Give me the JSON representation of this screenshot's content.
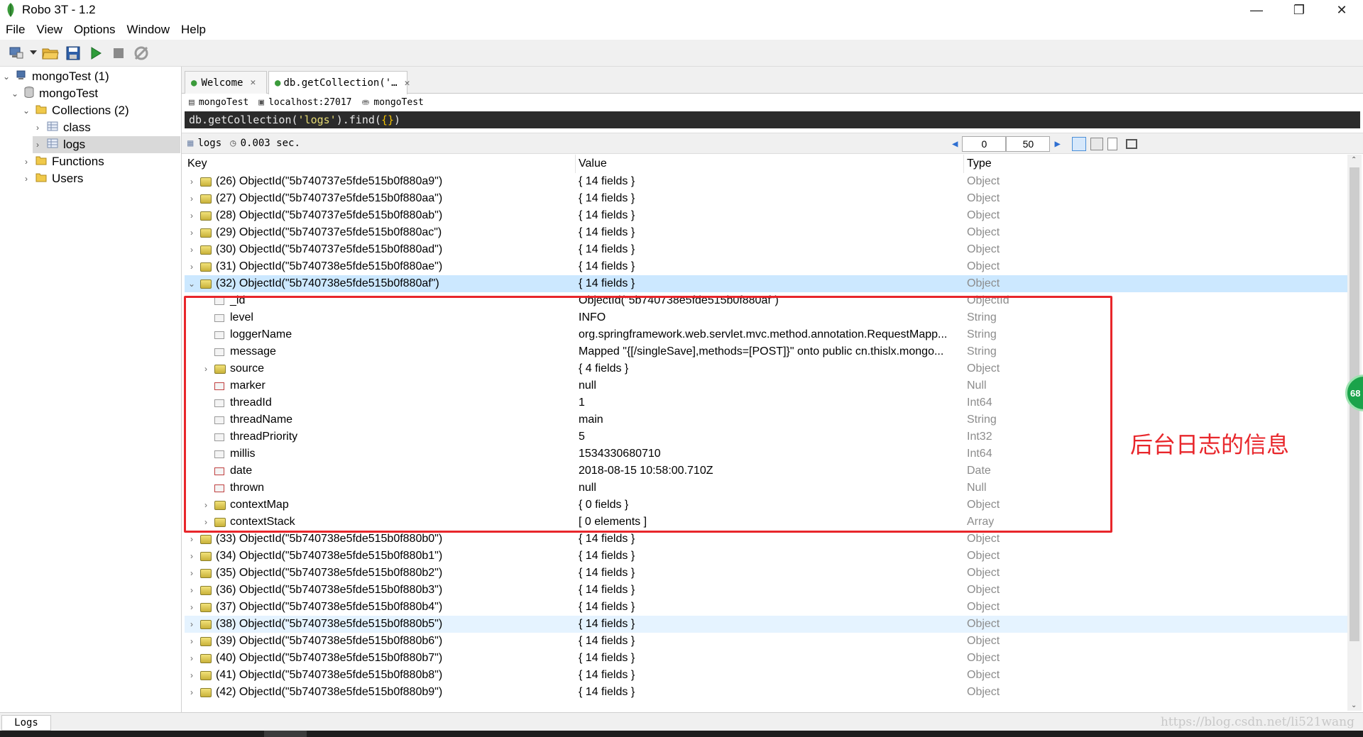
{
  "window": {
    "title": "Robo 3T - 1.2"
  },
  "menu": [
    "File",
    "View",
    "Options",
    "Window",
    "Help"
  ],
  "toolbar": {
    "icons": [
      "connect-icon",
      "dropdown-icon",
      "open-folder-icon",
      "save-icon",
      "run-icon",
      "stop-icon",
      "tools-icon"
    ]
  },
  "tree": {
    "connection": "mongoTest (1)",
    "database": "mongoTest",
    "collections": "Collections (2)",
    "items": [
      "class",
      "logs"
    ],
    "functions": "Functions",
    "users": "Users"
  },
  "tabs": [
    {
      "label": "Welcome"
    },
    {
      "label": "db.getCollection('…"
    }
  ],
  "connbar": {
    "db": "mongoTest",
    "host": "localhost:27017",
    "db2": "mongoTest"
  },
  "query": {
    "prefix": "db.getCollection(",
    "arg": "'logs'",
    "mid": ").find(",
    "args": "{}",
    "suffix": ")"
  },
  "results": {
    "collection": "logs",
    "time": "0.003 sec.",
    "skip": "0",
    "limit": "50"
  },
  "grid": {
    "headers": {
      "key": "Key",
      "value": "Value",
      "type": "Type"
    },
    "rows_before": [
      {
        "key": "(26) ObjectId(\"5b740737e5fde515b0f880a9\")",
        "value": "{ 14 fields }",
        "type": "Object"
      },
      {
        "key": "(27) ObjectId(\"5b740737e5fde515b0f880aa\")",
        "value": "{ 14 fields }",
        "type": "Object"
      },
      {
        "key": "(28) ObjectId(\"5b740737e5fde515b0f880ab\")",
        "value": "{ 14 fields }",
        "type": "Object"
      },
      {
        "key": "(29) ObjectId(\"5b740737e5fde515b0f880ac\")",
        "value": "{ 14 fields }",
        "type": "Object"
      },
      {
        "key": "(30) ObjectId(\"5b740737e5fde515b0f880ad\")",
        "value": "{ 14 fields }",
        "type": "Object"
      },
      {
        "key": "(31) ObjectId(\"5b740738e5fde515b0f880ae\")",
        "value": "{ 14 fields }",
        "type": "Object"
      }
    ],
    "expanded": {
      "key": "(32) ObjectId(\"5b740738e5fde515b0f880af\")",
      "value": "{ 14 fields }",
      "type": "Object"
    },
    "fields": [
      {
        "key": "_id",
        "value": "ObjectId(\"5b740738e5fde515b0f880af\")",
        "type": "ObjectId"
      },
      {
        "key": "level",
        "value": "INFO",
        "type": "String"
      },
      {
        "key": "loggerName",
        "value": "org.springframework.web.servlet.mvc.method.annotation.RequestMapp...",
        "type": "String"
      },
      {
        "key": "message",
        "value": "Mapped \"{[/singleSave],methods=[POST]}\" onto public cn.thislx.mongo...",
        "type": "String"
      },
      {
        "key": "source",
        "value": "{ 4 fields }",
        "type": "Object"
      },
      {
        "key": "marker",
        "value": "null",
        "type": "Null"
      },
      {
        "key": "threadId",
        "value": "1",
        "type": "Int64"
      },
      {
        "key": "threadName",
        "value": "main",
        "type": "String"
      },
      {
        "key": "threadPriority",
        "value": "5",
        "type": "Int32"
      },
      {
        "key": "millis",
        "value": "1534330680710",
        "type": "Int64"
      },
      {
        "key": "date",
        "value": "2018-08-15 10:58:00.710Z",
        "type": "Date"
      },
      {
        "key": "thrown",
        "value": "null",
        "type": "Null"
      },
      {
        "key": "contextMap",
        "value": "{ 0 fields }",
        "type": "Object"
      },
      {
        "key": "contextStack",
        "value": "[ 0 elements ]",
        "type": "Array"
      }
    ],
    "rows_after": [
      {
        "key": "(33) ObjectId(\"5b740738e5fde515b0f880b0\")",
        "value": "{ 14 fields }",
        "type": "Object"
      },
      {
        "key": "(34) ObjectId(\"5b740738e5fde515b0f880b1\")",
        "value": "{ 14 fields }",
        "type": "Object"
      },
      {
        "key": "(35) ObjectId(\"5b740738e5fde515b0f880b2\")",
        "value": "{ 14 fields }",
        "type": "Object"
      },
      {
        "key": "(36) ObjectId(\"5b740738e5fde515b0f880b3\")",
        "value": "{ 14 fields }",
        "type": "Object"
      },
      {
        "key": "(37) ObjectId(\"5b740738e5fde515b0f880b4\")",
        "value": "{ 14 fields }",
        "type": "Object"
      },
      {
        "key": "(38) ObjectId(\"5b740738e5fde515b0f880b5\")",
        "value": "{ 14 fields }",
        "type": "Object"
      },
      {
        "key": "(39) ObjectId(\"5b740738e5fde515b0f880b6\")",
        "value": "{ 14 fields }",
        "type": "Object"
      },
      {
        "key": "(40) ObjectId(\"5b740738e5fde515b0f880b7\")",
        "value": "{ 14 fields }",
        "type": "Object"
      },
      {
        "key": "(41) ObjectId(\"5b740738e5fde515b0f880b8\")",
        "value": "{ 14 fields }",
        "type": "Object"
      },
      {
        "key": "(42) ObjectId(\"5b740738e5fde515b0f880b9\")",
        "value": "{ 14 fields }",
        "type": "Object"
      }
    ]
  },
  "annotation": "后台日志的信息",
  "badge": "68",
  "status": {
    "tab": "Logs",
    "watermark": "https://blog.csdn.net/li521wang"
  },
  "colors": {
    "highlight_box": "#e8262b",
    "selected_row": "#cce8ff",
    "query_bg": "#2b2b2b"
  }
}
